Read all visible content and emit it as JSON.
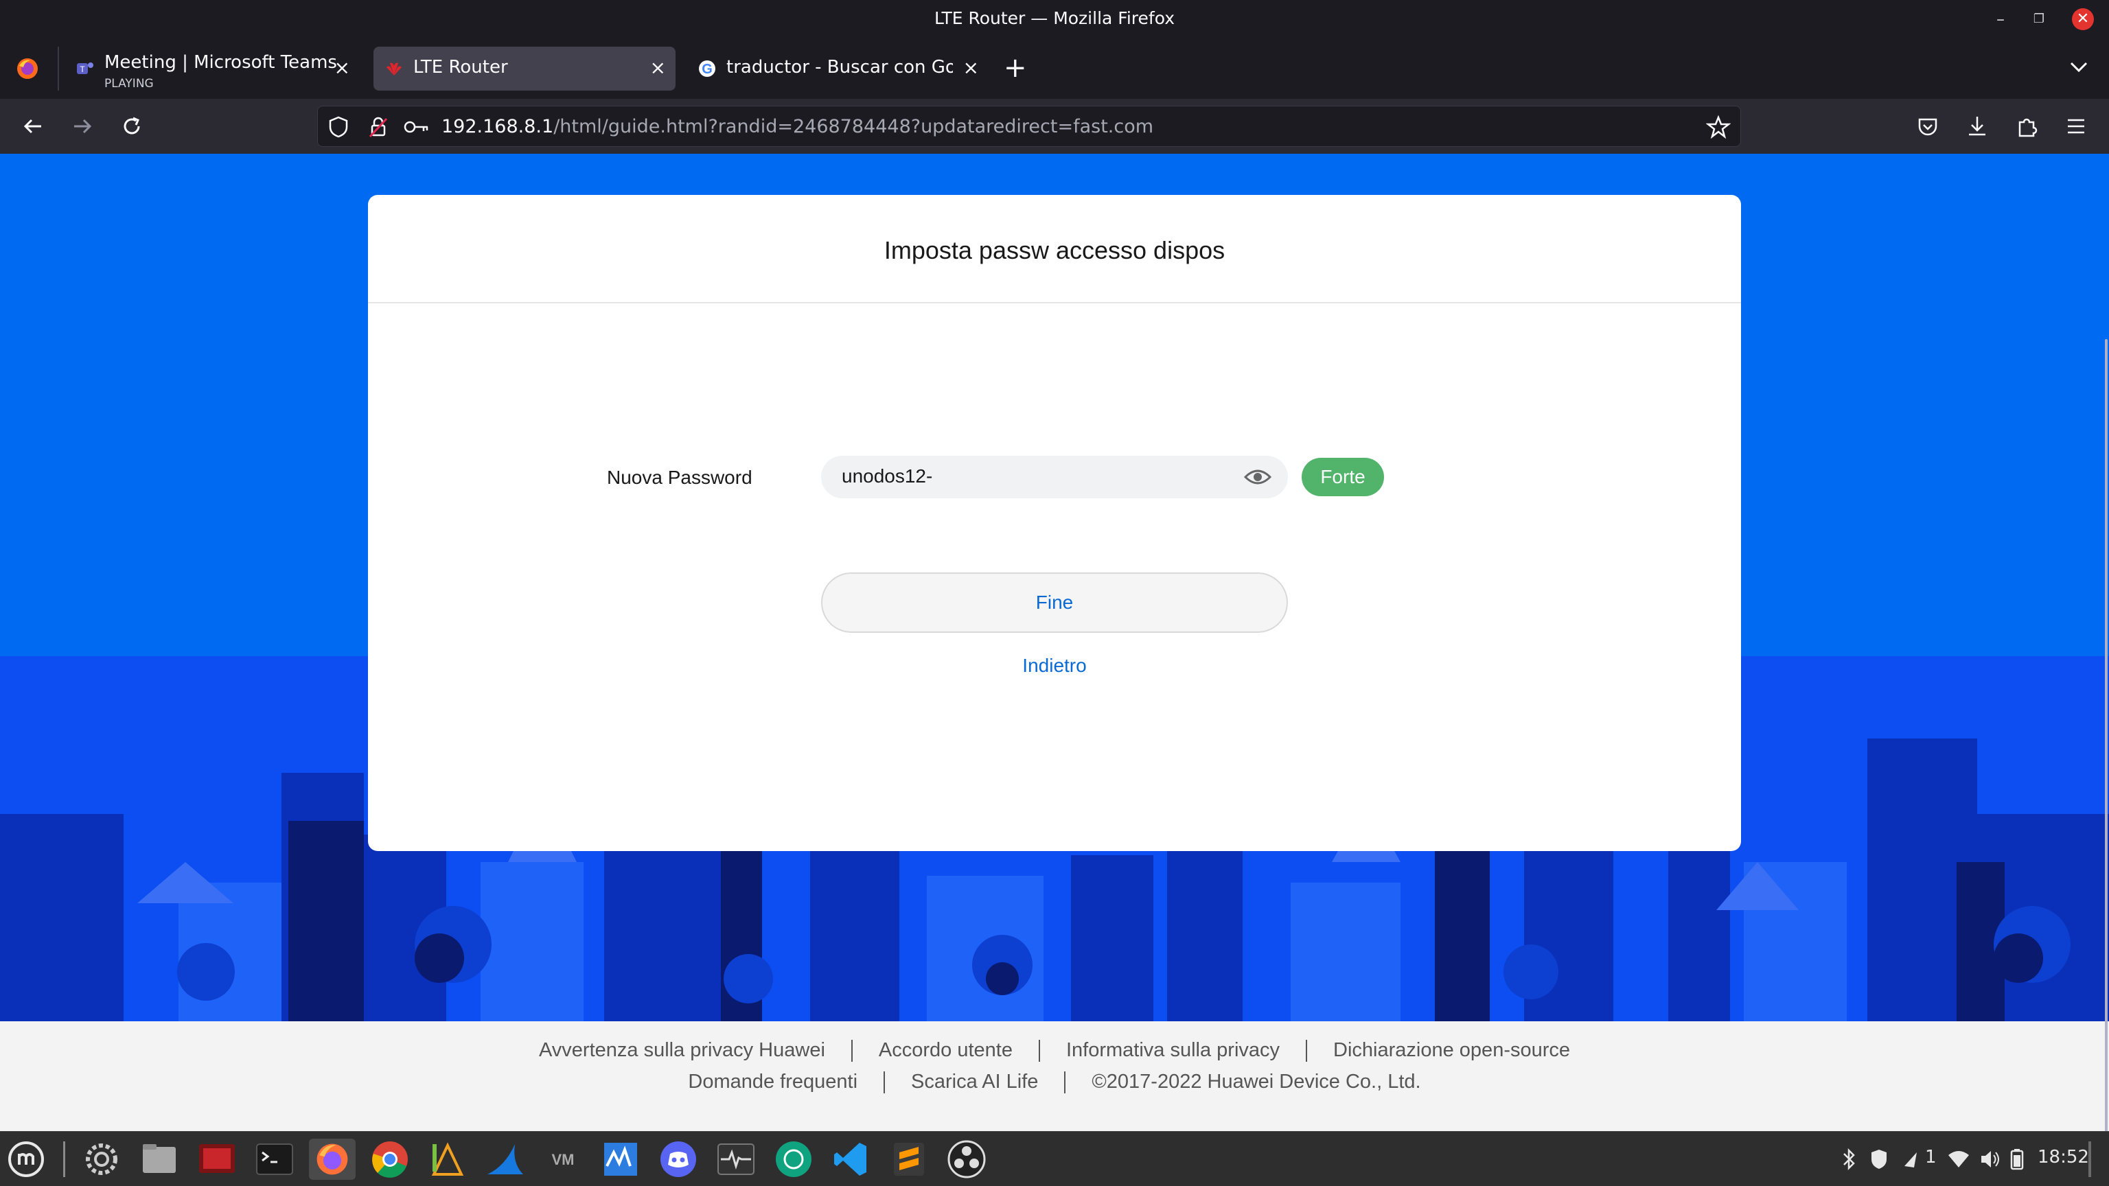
{
  "window": {
    "title": "LTE Router — Mozilla Firefox"
  },
  "tabs": [
    {
      "label": "Meeting | Microsoft Teams",
      "sub": "PLAYING"
    },
    {
      "label": "LTE Router"
    },
    {
      "label": "traductor - Buscar con Goog"
    }
  ],
  "urlbar": {
    "host": "192.168.8.1",
    "path": "/html/guide.html?randid=2468784448?updataredirect=fast.com"
  },
  "card": {
    "title": "Imposta passw accesso dispos",
    "password_label": "Nuova Password",
    "password_value": "unodos12-",
    "strength": "Forte",
    "finish_button": "Fine",
    "back_link": "Indietro"
  },
  "footer": {
    "row1": [
      "Avvertenza sulla privacy Huawei",
      "Accordo utente",
      "Informativa sulla privacy",
      "Dichiarazione open-source"
    ],
    "row2": [
      "Domande frequenti",
      "Scarica AI Life",
      "©2017-2022 Huawei Device Co., Ltd."
    ]
  },
  "taskbar": {
    "clock": "18:52",
    "workspace_count": "1"
  },
  "colors": {
    "page_background": "#006af3",
    "skyline": "#0a4bf0",
    "accent_link": "#0a6ad4",
    "strength_badge": "#52b36a"
  },
  "icons": [
    "firefox-icon",
    "teams-icon",
    "huawei-icon",
    "google-icon",
    "back-icon",
    "forward-icon",
    "reload-icon",
    "shield-icon",
    "lock-icon",
    "key-icon",
    "star-icon",
    "pocket-icon",
    "download-icon",
    "extensions-icon",
    "menu-icon",
    "eye-icon"
  ]
}
